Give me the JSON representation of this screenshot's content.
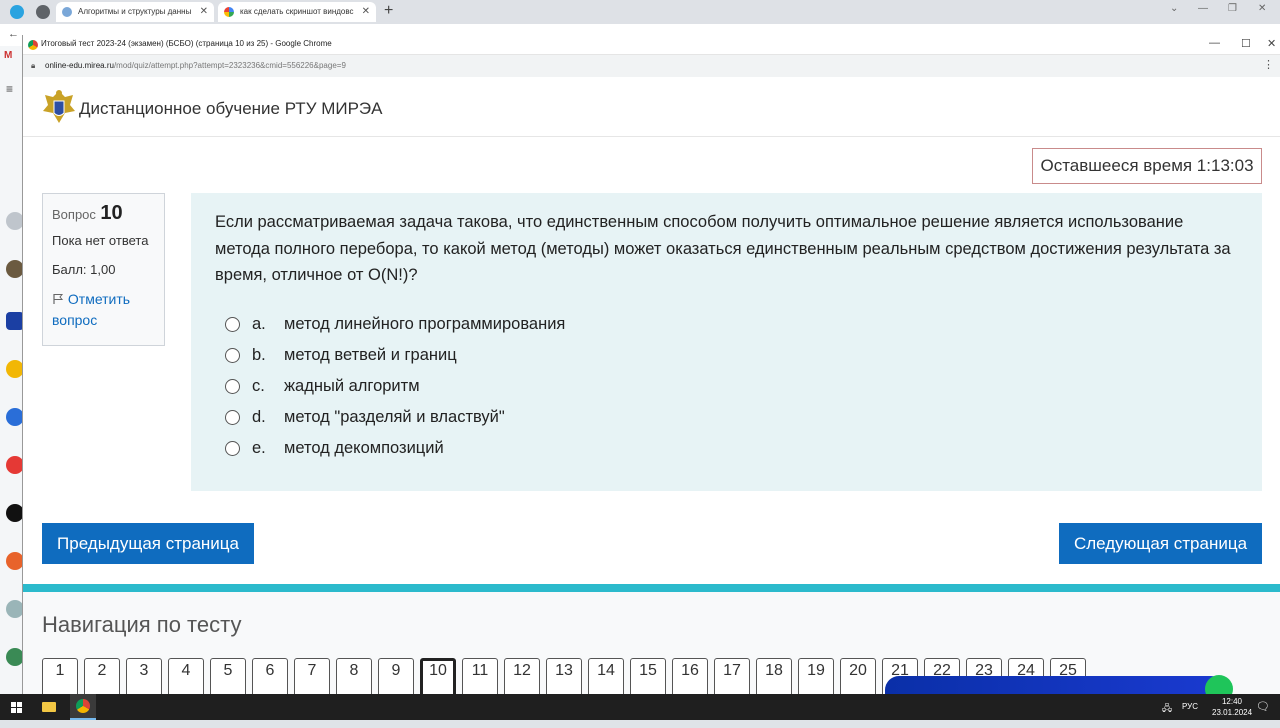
{
  "bg_browser": {
    "tab1_title": "Алгоритмы и структуры данны",
    "tab2_title": "как сделать скриншот виндовс"
  },
  "popup": {
    "window_title": "Итоговый тест 2023-24 (экзамен) (БСБО) (страница 10 из 25) - Google Chrome",
    "url_host": "online-edu.mirea.ru",
    "url_path": "/mod/quiz/attempt.php?attempt=2323236&cmid=556226&page=9"
  },
  "site": {
    "title": "Дистанционное обучение РТУ МИРЭА"
  },
  "timer": {
    "text": "Оставшееся время 1:13:03"
  },
  "question_info": {
    "label": "Вопрос",
    "number": "10",
    "status": "Пока нет ответа",
    "grade": "Балл: 1,00",
    "flag_label": "Отметить вопрос"
  },
  "question": {
    "text": "Если рассматриваемая задача такова, что единственным способом получить оптимальное решение является использование метода полного перебора, то какой метод (методы) может оказаться единственным реальным средством достижения результата за время, отличное от O(N!)?",
    "answers": [
      {
        "letter": "a.",
        "text": "метод линейного программирования"
      },
      {
        "letter": "b.",
        "text": "метод ветвей и границ"
      },
      {
        "letter": "c.",
        "text": "жадный алгоритм"
      },
      {
        "letter": "d.",
        "text": "метод \"разделяй и властвуй\""
      },
      {
        "letter": "e.",
        "text": "метод декомпозиций"
      }
    ]
  },
  "buttons": {
    "prev": "Предыдущая страница",
    "next": "Следующая страница"
  },
  "quiz_nav": {
    "title": "Навигация по тесту",
    "pages": [
      "1",
      "2",
      "3",
      "4",
      "5",
      "6",
      "7",
      "8",
      "9",
      "10",
      "11",
      "12",
      "13",
      "14",
      "15",
      "16",
      "17",
      "18",
      "19",
      "20",
      "21",
      "22",
      "23",
      "24",
      "25"
    ],
    "current": "10"
  },
  "taskbar": {
    "lang": "РУС",
    "time": "12:40",
    "date": "23.01.2024"
  }
}
